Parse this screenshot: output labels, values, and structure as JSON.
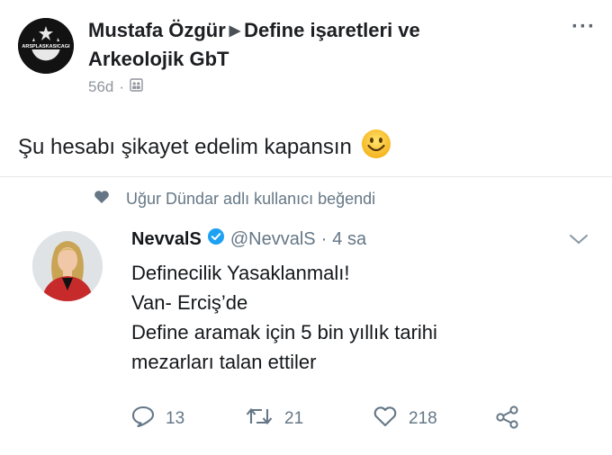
{
  "post": {
    "author": "Mustafa Özgür",
    "group": "Define işaretleri ve Arkeolojik GbT",
    "group_line1": "Define işaretleri ve",
    "group_line2": "Arkeolojik GbT",
    "time": "56d",
    "separator": "·",
    "more": "···",
    "text": "Şu hesabı şikayet edelim kapansın",
    "avatar_logo_text": "ARSPLASKASICAGI"
  },
  "tweet": {
    "liked_by": "Uğur Dündar adlı kullanıcı beğendi",
    "name": "NevvalS",
    "handle": "@NevvalS",
    "dot": "·",
    "time": "4 sa",
    "lines": [
      "Definecilik Yasaklanmalı!",
      "Van- Erciş’de",
      "Define aramak için 5 bin yıllık tarihi",
      "mezarları talan ettiler"
    ],
    "replies": "13",
    "retweets": "21",
    "likes": "218"
  },
  "colors": {
    "text": "#1c1e21",
    "meta": "#90949c",
    "twitter_gray": "#657786",
    "verified_blue": "#1da1f2",
    "jacket_red": "#c62a2a"
  },
  "icons": [
    "group-privacy-icon",
    "heart-icon",
    "verified-icon",
    "chevron-down-icon",
    "reply-icon",
    "retweet-icon",
    "like-icon",
    "share-icon",
    "smiley-emoji-icon"
  ]
}
